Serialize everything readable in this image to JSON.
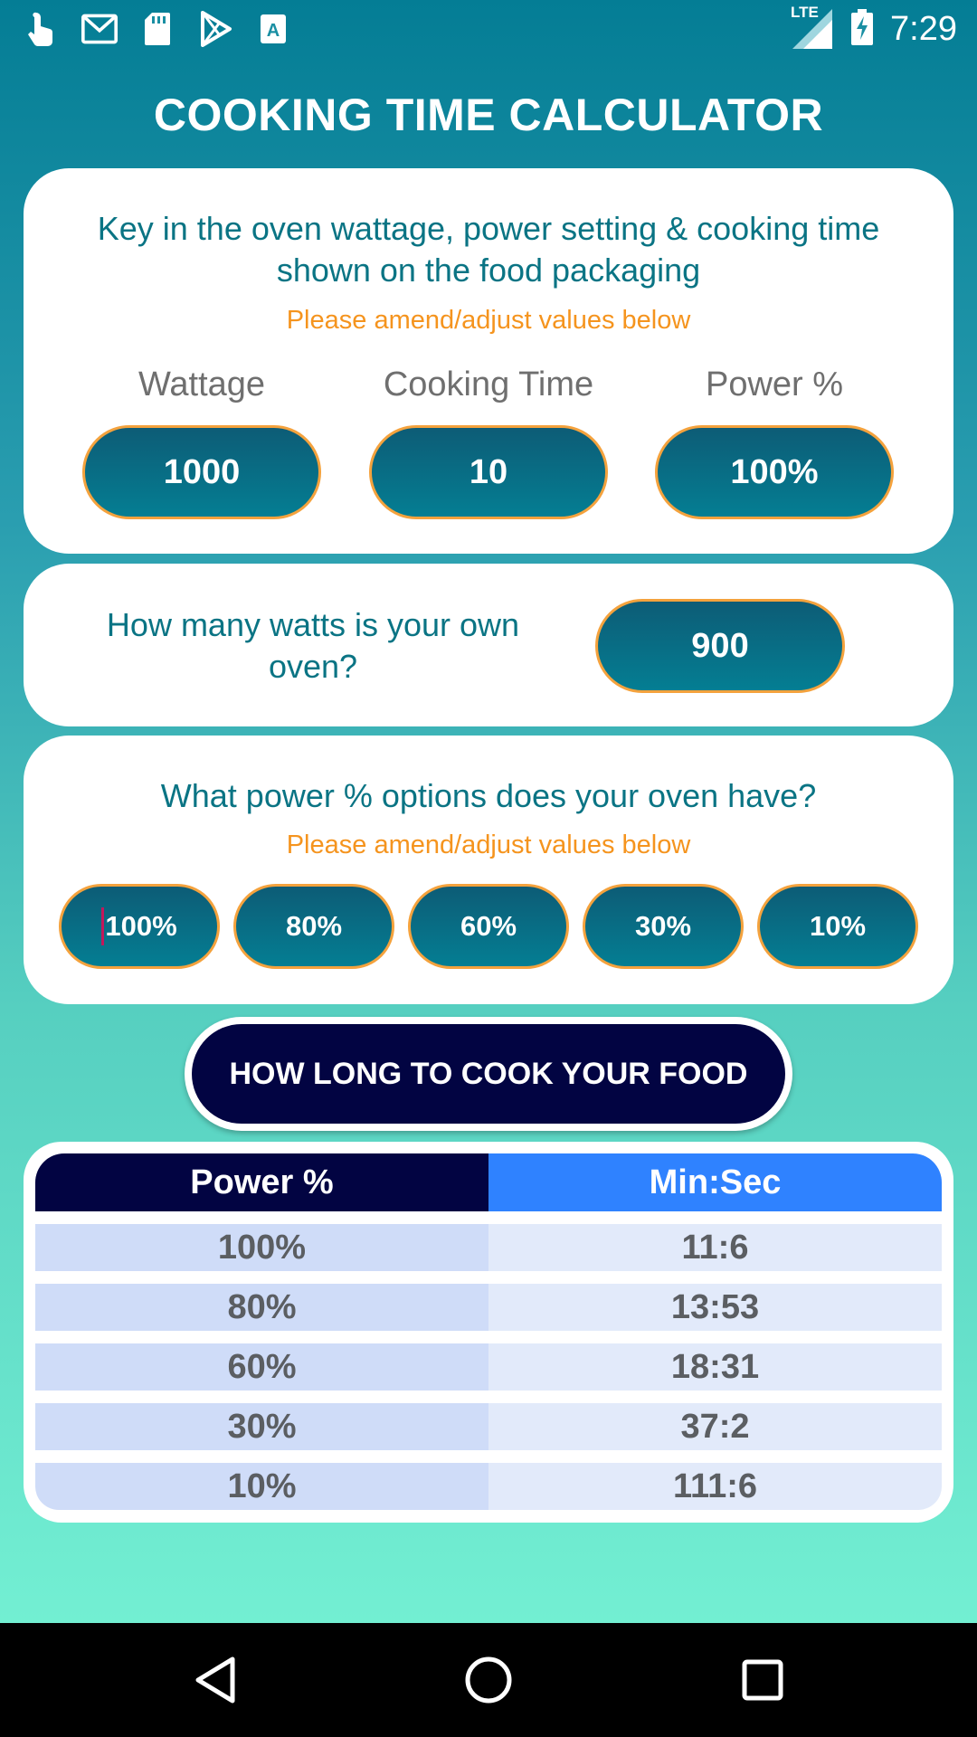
{
  "status": {
    "time": "7:29",
    "network": "LTE",
    "left_icons": [
      "touch-icon",
      "gmail-icon",
      "sd-card-icon",
      "play-store-icon",
      "accessibility-icon"
    ]
  },
  "title": "COOKING TIME CALCULATOR",
  "packaging": {
    "heading": "Key in the oven wattage, power setting & cooking time shown on the food packaging",
    "note": "Please amend/adjust values below",
    "labels": {
      "wattage": "Wattage",
      "cooking_time": "Cooking Time",
      "power": "Power %"
    },
    "values": {
      "wattage": "1000",
      "cooking_time": "10",
      "power": "100%"
    }
  },
  "own_oven": {
    "question": "How many watts is your own oven?",
    "value": "900"
  },
  "power_options": {
    "heading": "What power % options does your oven have?",
    "note": "Please amend/adjust values below",
    "values": [
      "100%",
      "80%",
      "60%",
      "30%",
      "10%"
    ]
  },
  "calculate_button": "HOW LONG TO COOK YOUR FOOD",
  "results": {
    "headers": [
      "Power %",
      "Min:Sec"
    ],
    "rows": [
      [
        "100%",
        "11:6"
      ],
      [
        "80%",
        "13:53"
      ],
      [
        "60%",
        "18:31"
      ],
      [
        "30%",
        "37:2"
      ],
      [
        "10%",
        "111:6"
      ]
    ]
  },
  "colors": {
    "accent_teal": "#0a7484",
    "note_orange": "#f5941e",
    "button_navy": "#020442",
    "header_blue": "#2f82ff"
  }
}
